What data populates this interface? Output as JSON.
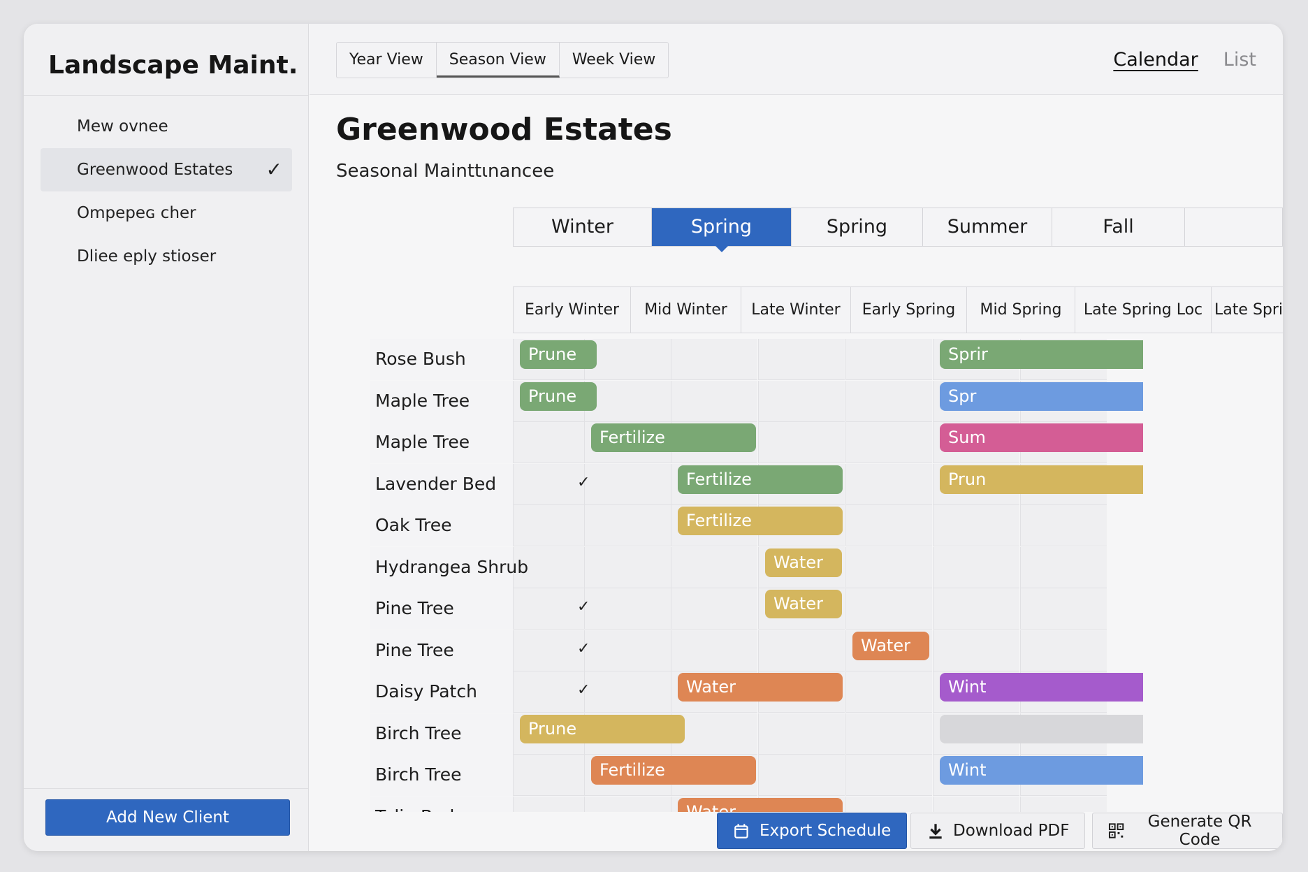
{
  "app": {
    "title": "Landscape Maint."
  },
  "sidebar": {
    "clients": [
      {
        "label": "Mew ovnee",
        "active": false
      },
      {
        "label": "Greenwood Estates",
        "active": true
      },
      {
        "label": "Ompepeɢ cher",
        "active": false
      },
      {
        "label": "Dliee eply stioser",
        "active": false
      }
    ],
    "add_client_label": "Add New Client"
  },
  "topbar": {
    "view_tabs": [
      "Year View",
      "Season View",
      "Week View"
    ],
    "active_view": "Season View",
    "modes": [
      "Calendar",
      "List"
    ],
    "active_mode": "Calendar"
  },
  "page": {
    "title": "Greenwood Estates",
    "subtitle": "Seasonal Mainttɩnancee"
  },
  "schedule": {
    "seasons": [
      "Winter",
      "Spring",
      "Spring",
      "Summer",
      "Fall"
    ],
    "active_season_index": 1,
    "periods": [
      "Early Winter",
      "Mid Winter",
      "Late Winter",
      "Early Spring",
      "Mid Spring",
      "Late Spring Loc",
      "Late Spring"
    ],
    "colors": {
      "green": "#7aa874",
      "yellow": "#d4b65e",
      "orange": "#de8654",
      "blue": "#6d9be0",
      "pink": "#d45d95",
      "purple": "#a55bcc",
      "gray": "#d7d7da"
    },
    "rows": [
      {
        "plant": "Rose Bush",
        "check": false,
        "tasks": [
          {
            "label": "Prune",
            "color": "green",
            "start": 0,
            "span": 1
          },
          {
            "label": "Sprir",
            "color": "green",
            "start": 5,
            "span": 1,
            "clipped": true
          }
        ]
      },
      {
        "plant": "Maple Tree",
        "check": false,
        "tasks": [
          {
            "label": "Prune",
            "color": "green",
            "start": 0,
            "span": 1
          },
          {
            "label": "Spr",
            "color": "blue",
            "start": 5,
            "span": 1,
            "clipped": true
          }
        ]
      },
      {
        "plant": "Maple Tree",
        "check": false,
        "tasks": [
          {
            "label": "Fertilize",
            "color": "green",
            "start": 1,
            "span": 2
          },
          {
            "label": "Sum",
            "color": "pink",
            "start": 5,
            "span": 1,
            "clipped": true
          }
        ]
      },
      {
        "plant": "Lavender Bed",
        "check": true,
        "tasks": [
          {
            "label": "Fertilize",
            "color": "green",
            "start": 2,
            "span": 2
          },
          {
            "label": "Prun",
            "color": "yellow",
            "start": 5,
            "span": 1,
            "clipped": true
          }
        ]
      },
      {
        "plant": "Oak Tree",
        "check": false,
        "tasks": [
          {
            "label": "Fertilize",
            "color": "yellow",
            "start": 2,
            "span": 2
          }
        ]
      },
      {
        "plant": "Hydrangea Shrub",
        "check": false,
        "tasks": [
          {
            "label": "Water",
            "color": "yellow",
            "start": 3,
            "span": 1
          }
        ]
      },
      {
        "plant": "Pine Tree",
        "check": true,
        "tasks": [
          {
            "label": "Water",
            "color": "yellow",
            "start": 3,
            "span": 1
          }
        ]
      },
      {
        "plant": "Pine Tree",
        "check": true,
        "tasks": [
          {
            "label": "Water",
            "color": "orange",
            "start": 4,
            "span": 1
          }
        ]
      },
      {
        "plant": "Daisy Patch",
        "check": true,
        "tasks": [
          {
            "label": "Water",
            "color": "orange",
            "start": 2,
            "span": 2
          },
          {
            "label": "Wint",
            "color": "purple",
            "start": 5,
            "span": 1,
            "clipped": true
          }
        ]
      },
      {
        "plant": "Birch Tree",
        "check": false,
        "tasks": [
          {
            "label": "Prune",
            "color": "yellow",
            "start": 0,
            "span": 2
          },
          {
            "label": "",
            "color": "gray",
            "start": 5,
            "span": 1,
            "clipped": true
          }
        ]
      },
      {
        "plant": "Birch Tree",
        "check": false,
        "tasks": [
          {
            "label": "Fertilize",
            "color": "orange",
            "start": 1,
            "span": 2
          },
          {
            "label": "Wint",
            "color": "blue",
            "start": 5,
            "span": 1,
            "clipped": true
          }
        ]
      },
      {
        "plant": "Tulip Bed",
        "check": false,
        "tasks": [
          {
            "label": "Water",
            "color": "orange",
            "start": 2,
            "span": 2
          }
        ]
      }
    ]
  },
  "actions": {
    "export_label": "Export Schedule",
    "download_label": "Download PDF",
    "qr_label": "Generate QR Code"
  }
}
